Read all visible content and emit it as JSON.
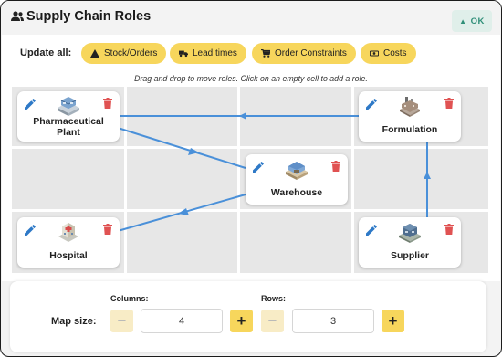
{
  "header": {
    "title": "Supply Chain Roles",
    "ok_label": "OK"
  },
  "toolbar": {
    "update_label": "Update all:",
    "buttons": [
      {
        "label": "Stock/Orders",
        "icon": "triangle-icon"
      },
      {
        "label": "Lead times",
        "icon": "truck-icon"
      },
      {
        "label": "Order Constraints",
        "icon": "cart-icon"
      },
      {
        "label": "Costs",
        "icon": "money-icon"
      }
    ],
    "hint": "Drag and drop to move roles. Click on an empty cell to add a role."
  },
  "map": {
    "columns": 4,
    "rows": 3,
    "roles": [
      {
        "name_line1": "Pharmaceutical",
        "name_line2": "Plant",
        "col": 1,
        "row": 1,
        "icon": "factory-icon"
      },
      {
        "name_line1": "Formulation",
        "name_line2": "",
        "col": 4,
        "row": 1,
        "icon": "plant-icon"
      },
      {
        "name_line1": "Warehouse",
        "name_line2": "",
        "col": 3,
        "row": 2,
        "icon": "warehouse-icon"
      },
      {
        "name_line1": "Hospital",
        "name_line2": "",
        "col": 1,
        "row": 3,
        "icon": "hospital-icon"
      },
      {
        "name_line1": "Supplier",
        "name_line2": "",
        "col": 4,
        "row": 3,
        "icon": "supplier-icon"
      }
    ],
    "links": [
      {
        "from": "Supplier",
        "to": "Formulation"
      },
      {
        "from": "Formulation",
        "to": "Pharmaceutical Plant"
      },
      {
        "from": "Pharmaceutical Plant",
        "to": "Warehouse"
      },
      {
        "from": "Warehouse",
        "to": "Hospital"
      }
    ],
    "link_color": "#4a90d9"
  },
  "footer": {
    "map_size_label": "Map size:",
    "columns_label": "Columns:",
    "rows_label": "Rows:",
    "columns_value": "4",
    "rows_value": "3",
    "minus": "−",
    "plus": "+"
  },
  "colors": {
    "accent": "#f7d65c",
    "ok_text": "#2f8f78",
    "delete": "#e05252",
    "edit": "#2e79c7"
  }
}
